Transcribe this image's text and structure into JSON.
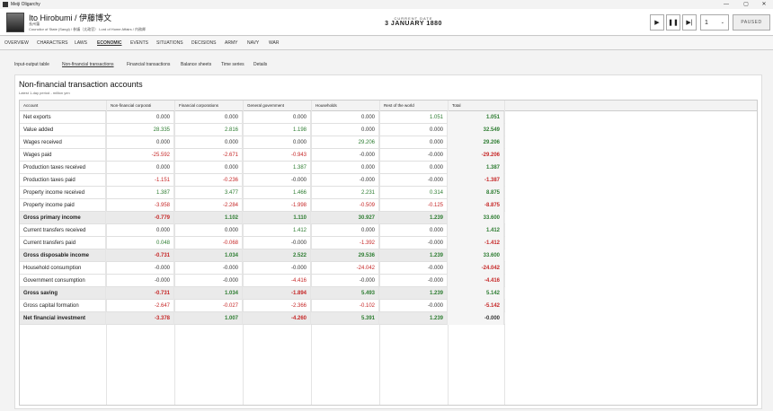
{
  "window": {
    "title": "Meiji Oligarchy"
  },
  "character": {
    "name": "Ito Hirobumi  /  伊藤博文",
    "kana": "長州藩",
    "roles": "Councilor of State (Sangi)  /  参議（太政官）   Lord of Home Affairs  /  内務卿"
  },
  "date": {
    "label": "CURRENT DATE",
    "value": "3  JANUARY  1880"
  },
  "speed": {
    "value": "1",
    "paused_label": "PAUSED"
  },
  "nav_tabs": [
    "OVERVIEW",
    "CHARACTERS",
    "LAWS",
    "ECONOMIC",
    "EVENTS",
    "SITUATIONS",
    "DECISIONS",
    "ARMY",
    "NAVY",
    "WAR"
  ],
  "sub_tabs": [
    "Input-output table",
    "Non-financial transactions",
    "Financial transactions",
    "Balance sheets",
    "Time series",
    "Details"
  ],
  "panel": {
    "title": "Non-financial transaction accounts",
    "subtitle": "Latest 1-day period - million yen"
  },
  "table": {
    "headers": [
      "Account",
      "Non-financial corporati",
      "Financial corporations",
      "General government",
      "Households",
      "Rest of the world",
      "Total"
    ],
    "rows": [
      {
        "label": "Net exports",
        "bold": false,
        "values": [
          "0.000",
          "0.000",
          "0.000",
          "0.000",
          "1.051",
          "1.051"
        ]
      },
      {
        "label": "Value added",
        "bold": false,
        "values": [
          "28.335",
          "2.816",
          "1.198",
          "0.000",
          "0.000",
          "32.549"
        ]
      },
      {
        "label": "Wages received",
        "bold": false,
        "values": [
          "0.000",
          "0.000",
          "0.000",
          "29.206",
          "0.000",
          "29.206"
        ]
      },
      {
        "label": "Wages paid",
        "bold": false,
        "values": [
          "-25.592",
          "-2.671",
          "-0.943",
          "-0.000",
          "-0.000",
          "-29.206"
        ]
      },
      {
        "label": "Production taxes received",
        "bold": false,
        "values": [
          "0.000",
          "0.000",
          "1.387",
          "0.000",
          "0.000",
          "1.387"
        ]
      },
      {
        "label": "Production taxes paid",
        "bold": false,
        "values": [
          "-1.151",
          "-0.236",
          "-0.000",
          "-0.000",
          "-0.000",
          "-1.387"
        ]
      },
      {
        "label": "Property income received",
        "bold": false,
        "values": [
          "1.387",
          "3.477",
          "1.466",
          "2.231",
          "0.314",
          "8.875"
        ]
      },
      {
        "label": "Property income paid",
        "bold": false,
        "values": [
          "-3.958",
          "-2.284",
          "-1.998",
          "-0.509",
          "-0.125",
          "-8.875"
        ]
      },
      {
        "label": "Gross primary income",
        "bold": true,
        "values": [
          "-0.779",
          "1.102",
          "1.110",
          "30.927",
          "1.239",
          "33.600"
        ]
      },
      {
        "label": "Current transfers received",
        "bold": false,
        "values": [
          "0.000",
          "0.000",
          "1.412",
          "0.000",
          "0.000",
          "1.412"
        ]
      },
      {
        "label": "Current transfers paid",
        "bold": false,
        "values": [
          "0.048",
          "-0.068",
          "-0.000",
          "-1.392",
          "-0.000",
          "-1.412"
        ]
      },
      {
        "label": "Gross disposable income",
        "bold": true,
        "values": [
          "-0.731",
          "1.034",
          "2.522",
          "29.536",
          "1.239",
          "33.600"
        ]
      },
      {
        "label": "Household consumption",
        "bold": false,
        "values": [
          "-0.000",
          "-0.000",
          "-0.000",
          "-24.042",
          "-0.000",
          "-24.042"
        ]
      },
      {
        "label": "Government consumption",
        "bold": false,
        "values": [
          "-0.000",
          "-0.000",
          "-4.416",
          "-0.000",
          "-0.000",
          "-4.416"
        ]
      },
      {
        "label": "Gross saving",
        "bold": true,
        "values": [
          "-0.731",
          "1.034",
          "-1.894",
          "5.493",
          "1.239",
          "5.142"
        ]
      },
      {
        "label": "Gross capital formation",
        "bold": false,
        "values": [
          "-2.647",
          "-0.027",
          "-2.366",
          "-0.102",
          "-0.000",
          "-5.142"
        ]
      },
      {
        "label": "Net financial investment",
        "bold": true,
        "values": [
          "-3.378",
          "1.007",
          "-4.260",
          "5.391",
          "1.239",
          "-0.000"
        ]
      }
    ]
  }
}
